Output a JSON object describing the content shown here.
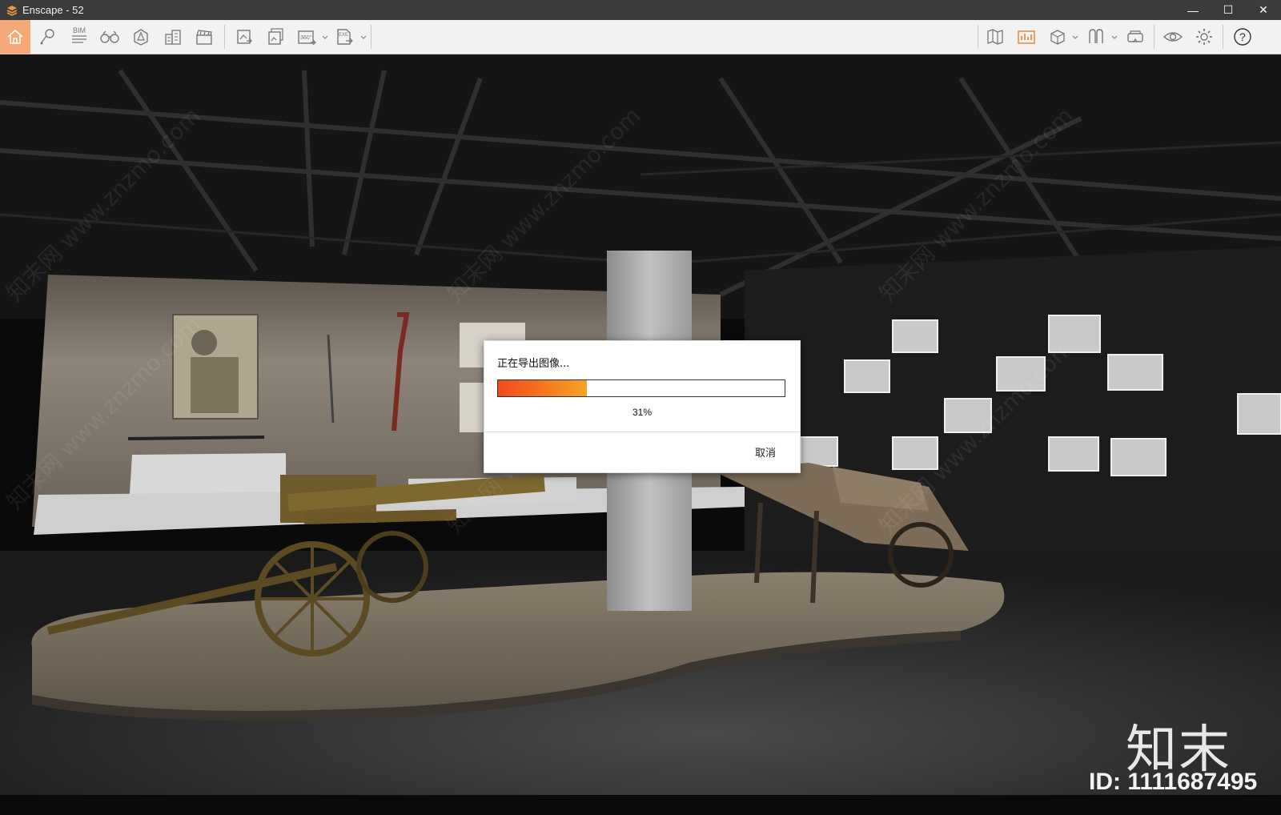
{
  "window": {
    "title": "Enscape - 52"
  },
  "window_controls": {
    "minimize": "—",
    "maximize": "☐",
    "close": "✕"
  },
  "toolbar": {
    "left_tools": [
      {
        "name": "home-icon"
      },
      {
        "name": "location-pin-icon"
      },
      {
        "name": "bim-icon",
        "label": "BIM"
      },
      {
        "name": "binoculars-icon"
      },
      {
        "name": "asset-library-icon"
      },
      {
        "name": "buildings-icon"
      },
      {
        "name": "clapperboard-icon"
      }
    ],
    "export_tools": [
      {
        "name": "screenshot-export-icon"
      },
      {
        "name": "batch-render-icon"
      },
      {
        "name": "panorama-360-icon",
        "label": "360°"
      },
      {
        "name": "exe-export-icon",
        "label": "EXE"
      }
    ],
    "right_tools": [
      {
        "name": "map-icon"
      },
      {
        "name": "visual-settings-icon"
      },
      {
        "name": "cube-view-icon"
      },
      {
        "name": "material-library-icon"
      },
      {
        "name": "vr-headset-icon"
      },
      {
        "name": "eye-icon"
      },
      {
        "name": "gear-icon"
      },
      {
        "name": "help-icon",
        "label": "?"
      }
    ],
    "accent_color": "#f07c2c"
  },
  "dialog": {
    "title": "正在导出图像...",
    "progress": 0.31,
    "percent_label": "31%",
    "cancel_label": "取消",
    "progress_gradient": [
      "#f04a1e",
      "#f7a326"
    ]
  },
  "watermark": {
    "logo": "知末",
    "id_text": "ID: 1111687495",
    "diagonal_text": "知末网 www.znzmo.com"
  }
}
